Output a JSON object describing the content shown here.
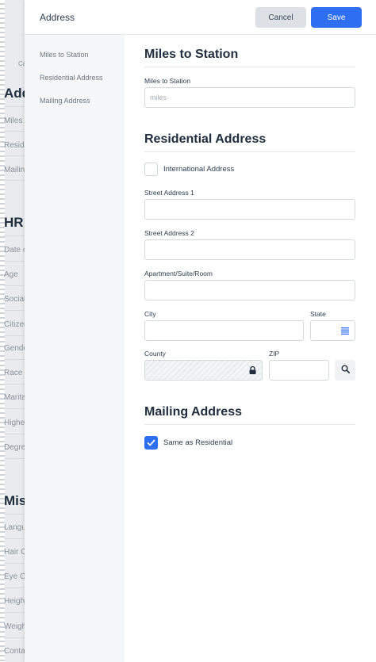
{
  "background": {
    "items_top": [
      "Ca",
      "Miles t",
      "Reside",
      "Mailin"
    ],
    "section_add": "Add",
    "section_hr": "HR",
    "hr_items": [
      "Date o",
      "Age",
      "Social",
      "Citizen",
      "Gende",
      "Race",
      "Marita",
      "Highe",
      "Degre"
    ],
    "section_mis": "Mis",
    "mis_items": [
      "Langu",
      "Hair C",
      "Eye Co",
      "Heigh",
      "Weigh",
      "Conta"
    ]
  },
  "panel": {
    "title": "Address",
    "cancel_label": "Cancel",
    "save_label": "Save"
  },
  "sidenav": {
    "items": [
      "Miles to Station",
      "Residential Address",
      "Mailing Address"
    ]
  },
  "miles": {
    "heading": "Miles to Station",
    "field_label": "Miles to Station",
    "placeholder": "miles"
  },
  "residential": {
    "heading": "Residential Address",
    "international_label": "International Address",
    "street1_label": "Street Address 1",
    "street2_label": "Street Address 2",
    "apartment_label": "Apartment/Suite/Room",
    "city_label": "City",
    "state_label": "State",
    "county_label": "County",
    "zip_label": "ZIP"
  },
  "mailing": {
    "heading": "Mailing Address",
    "same_label": "Same as Residential"
  },
  "colors": {
    "accent": "#2e6ef0",
    "cancel_bg": "#dde0e4"
  }
}
